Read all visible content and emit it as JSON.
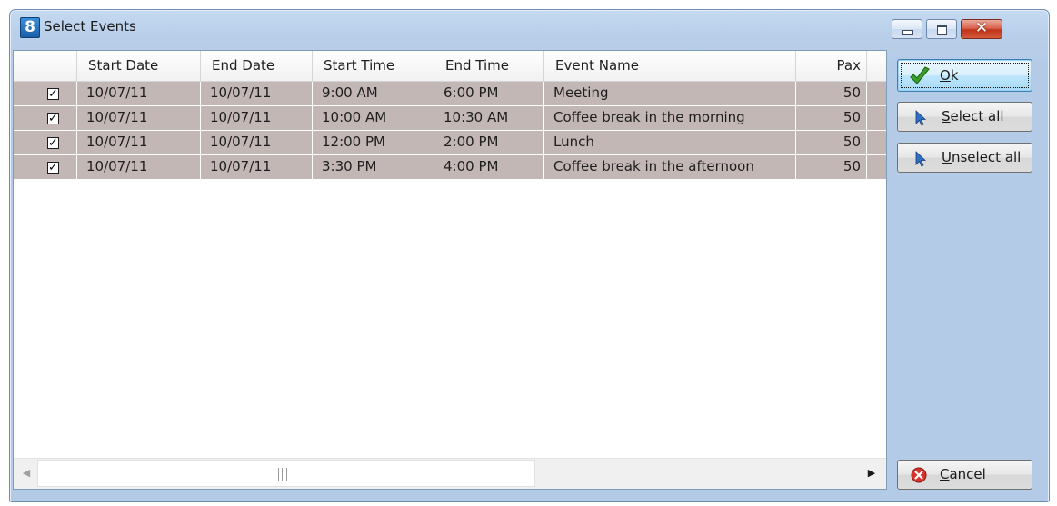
{
  "window": {
    "icon_text": "8",
    "title": "Select Events",
    "controls": {
      "minimize": "minimize",
      "maximize": "maximize",
      "close": "✕"
    }
  },
  "grid": {
    "columns": [
      "Start Date",
      "End Date",
      "Start Time",
      "End Time",
      "Event Name",
      "Pax"
    ],
    "rows": [
      {
        "checked": true,
        "start_date": "10/07/11",
        "end_date": "10/07/11",
        "start_time": "9:00 AM",
        "end_time": "6:00 PM",
        "event_name": "Meeting",
        "pax": "50"
      },
      {
        "checked": true,
        "start_date": "10/07/11",
        "end_date": "10/07/11",
        "start_time": "10:00 AM",
        "end_time": "10:30 AM",
        "event_name": "Coffee break in the morning",
        "pax": "50"
      },
      {
        "checked": true,
        "start_date": "10/07/11",
        "end_date": "10/07/11",
        "start_time": "12:00 PM",
        "end_time": "2:00 PM",
        "event_name": "Lunch",
        "pax": "50"
      },
      {
        "checked": true,
        "start_date": "10/07/11",
        "end_date": "10/07/11",
        "start_time": "3:30 PM",
        "end_time": "4:00 PM",
        "event_name": "Coffee break in the afternoon",
        "pax": "50"
      }
    ],
    "row_color": "#c2b7b5"
  },
  "buttons": {
    "ok": {
      "mnemonic": "O",
      "rest": "k",
      "icon": "checkmark-icon"
    },
    "select_all": {
      "mnemonic": "S",
      "rest": "elect all",
      "icon": "cursor-arrow-icon"
    },
    "unselect_all": {
      "mnemonic": "U",
      "rest": "nselect all",
      "icon": "cursor-arrow-icon"
    },
    "cancel": {
      "mnemonic": "C",
      "rest": "ancel",
      "icon": "cancel-x-icon"
    }
  }
}
